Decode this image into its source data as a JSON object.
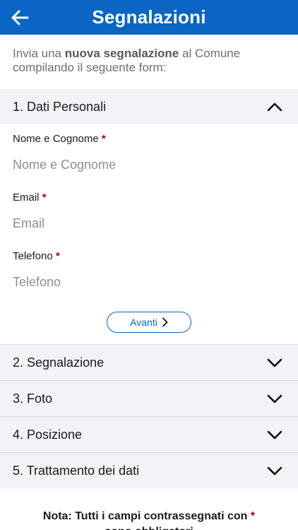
{
  "header": {
    "title": "Segnalazioni",
    "back_icon": "arrow-left-icon"
  },
  "intro": {
    "prefix": "Invia una ",
    "bold": "nuova segnalazione",
    "suffix": " al Comune compilando il seguente form:"
  },
  "sections": [
    {
      "label": "1. Dati Personali",
      "expanded": true
    },
    {
      "label": "2. Segnalazione",
      "expanded": false
    },
    {
      "label": "3. Foto",
      "expanded": false
    },
    {
      "label": "4. Posizione",
      "expanded": false
    },
    {
      "label": "5. Trattamento dei dati",
      "expanded": false
    }
  ],
  "form": {
    "required_mark": "*",
    "fields": [
      {
        "label": "Nome e Cognome",
        "placeholder": "Nome e Cognome",
        "value": ""
      },
      {
        "label": "Email",
        "placeholder": "Email",
        "value": ""
      },
      {
        "label": "Telefono",
        "placeholder": "Telefono",
        "value": ""
      }
    ],
    "next_label": "Avanti"
  },
  "note": {
    "line1": "Nota: Tutti i campi contrassegnati con ",
    "mark": "*",
    "line2": "sono obbligatori"
  },
  "colors": {
    "primary": "#0a66c2",
    "required": "#b00000",
    "section_bg": "#f2f3f7"
  }
}
